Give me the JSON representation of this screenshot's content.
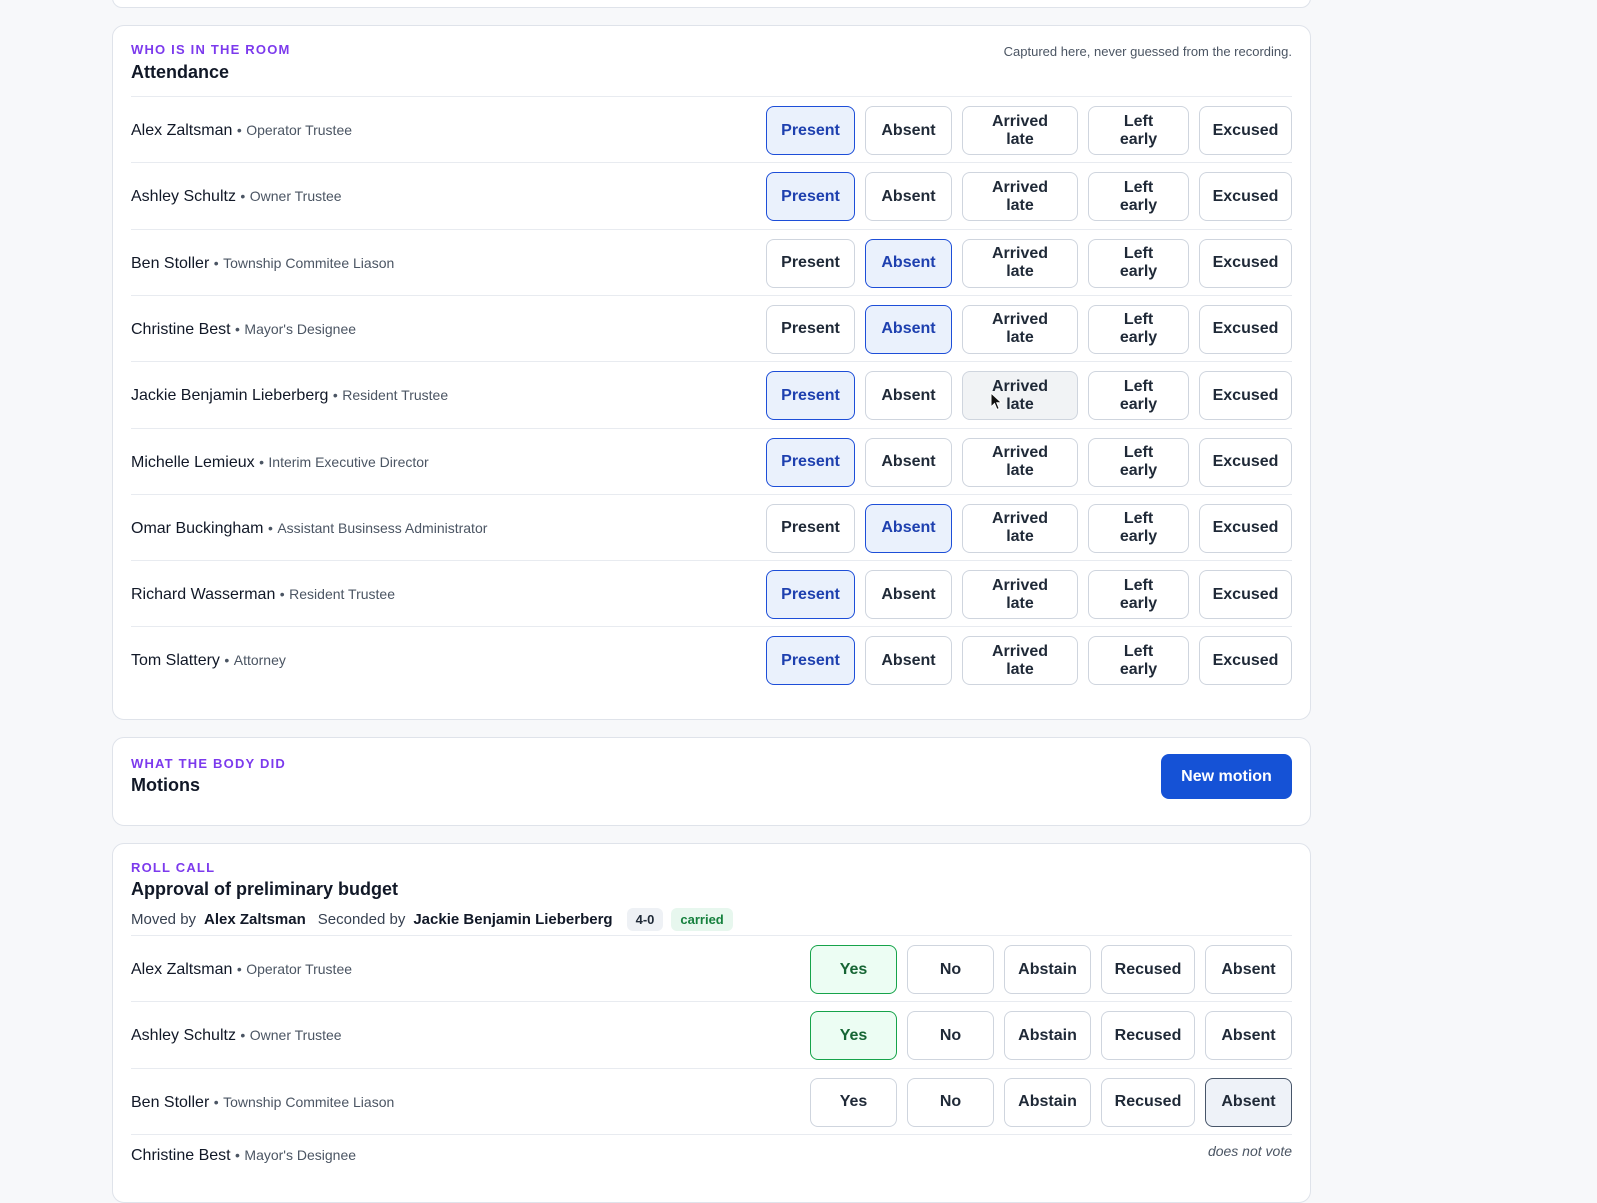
{
  "attendance": {
    "eyebrow": "WHO IS IN THE ROOM",
    "title": "Attendance",
    "note": "Captured here, never guessed from the recording.",
    "options": [
      "Present",
      "Absent",
      "Arrived late",
      "Left early",
      "Excused"
    ],
    "separator": "•",
    "rows": [
      {
        "name": "Alex Zaltsman",
        "role": "Operator Trustee",
        "status": "Present"
      },
      {
        "name": "Ashley Schultz",
        "role": "Owner Trustee",
        "status": "Present"
      },
      {
        "name": "Ben Stoller",
        "role": "Township Commitee Liason",
        "status": "Absent"
      },
      {
        "name": "Christine Best",
        "role": "Mayor's Designee",
        "status": "Absent"
      },
      {
        "name": "Jackie Benjamin Lieberberg",
        "role": "Resident Trustee",
        "status": "Present"
      },
      {
        "name": "Michelle Lemieux",
        "role": "Interim Executive Director",
        "status": "Present"
      },
      {
        "name": "Omar Buckingham",
        "role": "Assistant Businsess Administrator",
        "status": "Absent"
      },
      {
        "name": "Richard Wasserman",
        "role": "Resident Trustee",
        "status": "Present"
      },
      {
        "name": "Tom Slattery",
        "role": "Attorney",
        "status": "Present"
      }
    ]
  },
  "motions": {
    "eyebrow": "WHAT THE BODY DID",
    "title": "Motions",
    "new_button": "New motion"
  },
  "rollcall": {
    "eyebrow": "ROLL CALL",
    "title": "Approval of preliminary budget",
    "moved_label": "Moved by",
    "moved_by": "Alex Zaltsman",
    "seconded_label": "Seconded by",
    "seconded_by": "Jackie Benjamin Lieberberg",
    "tally": "4-0",
    "result": "carried",
    "options": [
      "Yes",
      "No",
      "Abstain",
      "Recused",
      "Absent"
    ],
    "rows": [
      {
        "name": "Alex Zaltsman",
        "role": "Operator Trustee",
        "vote": "Yes"
      },
      {
        "name": "Ashley Schultz",
        "role": "Owner Trustee",
        "vote": "Yes"
      },
      {
        "name": "Ben Stoller",
        "role": "Township Commitee Liason",
        "vote": "Absent"
      },
      {
        "name": "Christine Best",
        "role": "Mayor's Designee",
        "vote": "",
        "note": "does not vote"
      }
    ]
  },
  "colors": {
    "accent_purple": "#7c3aed",
    "primary_blue": "#1552d6",
    "selected_blue": "#1d4ed8",
    "yes_green": "#16a34a"
  }
}
